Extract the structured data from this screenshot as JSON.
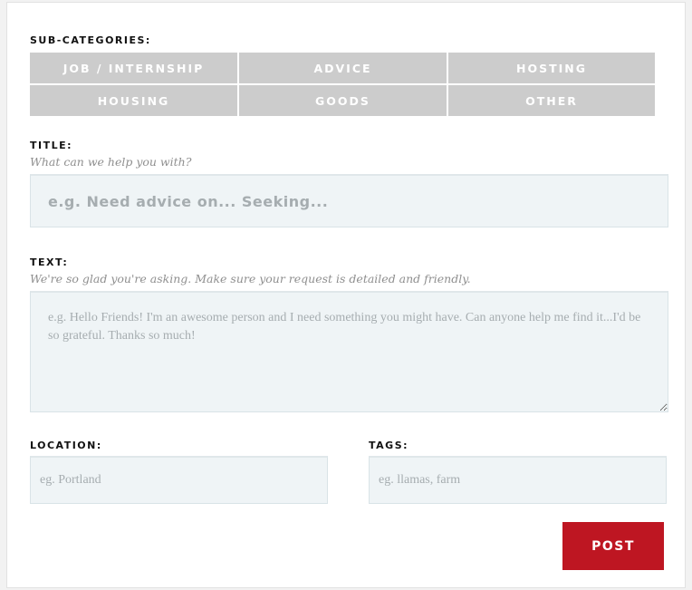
{
  "form": {
    "subcategories_label": "SUB-CATEGORIES:",
    "subcategories": [
      "JOB / INTERNSHIP",
      "ADVICE",
      "HOSTING",
      "HOUSING",
      "GOODS",
      "OTHER"
    ],
    "title": {
      "label": "TITLE:",
      "hint": "What can we help you with?",
      "placeholder": "e.g. Need advice on... Seeking...",
      "value": ""
    },
    "text": {
      "label": "TEXT:",
      "hint": "We're so glad you're asking. Make sure your request is detailed and friendly.",
      "placeholder": "e.g. Hello Friends! I'm an awesome person and I need something you might have. Can anyone help me find it...I'd be so grateful. Thanks so much!",
      "value": ""
    },
    "location": {
      "label": "LOCATION:",
      "placeholder": "eg. Portland",
      "value": ""
    },
    "tags": {
      "label": "TAGS:",
      "placeholder": "eg. llamas, farm",
      "value": ""
    },
    "post_label": "POST"
  },
  "colors": {
    "subcategory_bg": "#cccccc",
    "field_bg": "#eff4f6",
    "post_button_bg": "#be1622"
  }
}
